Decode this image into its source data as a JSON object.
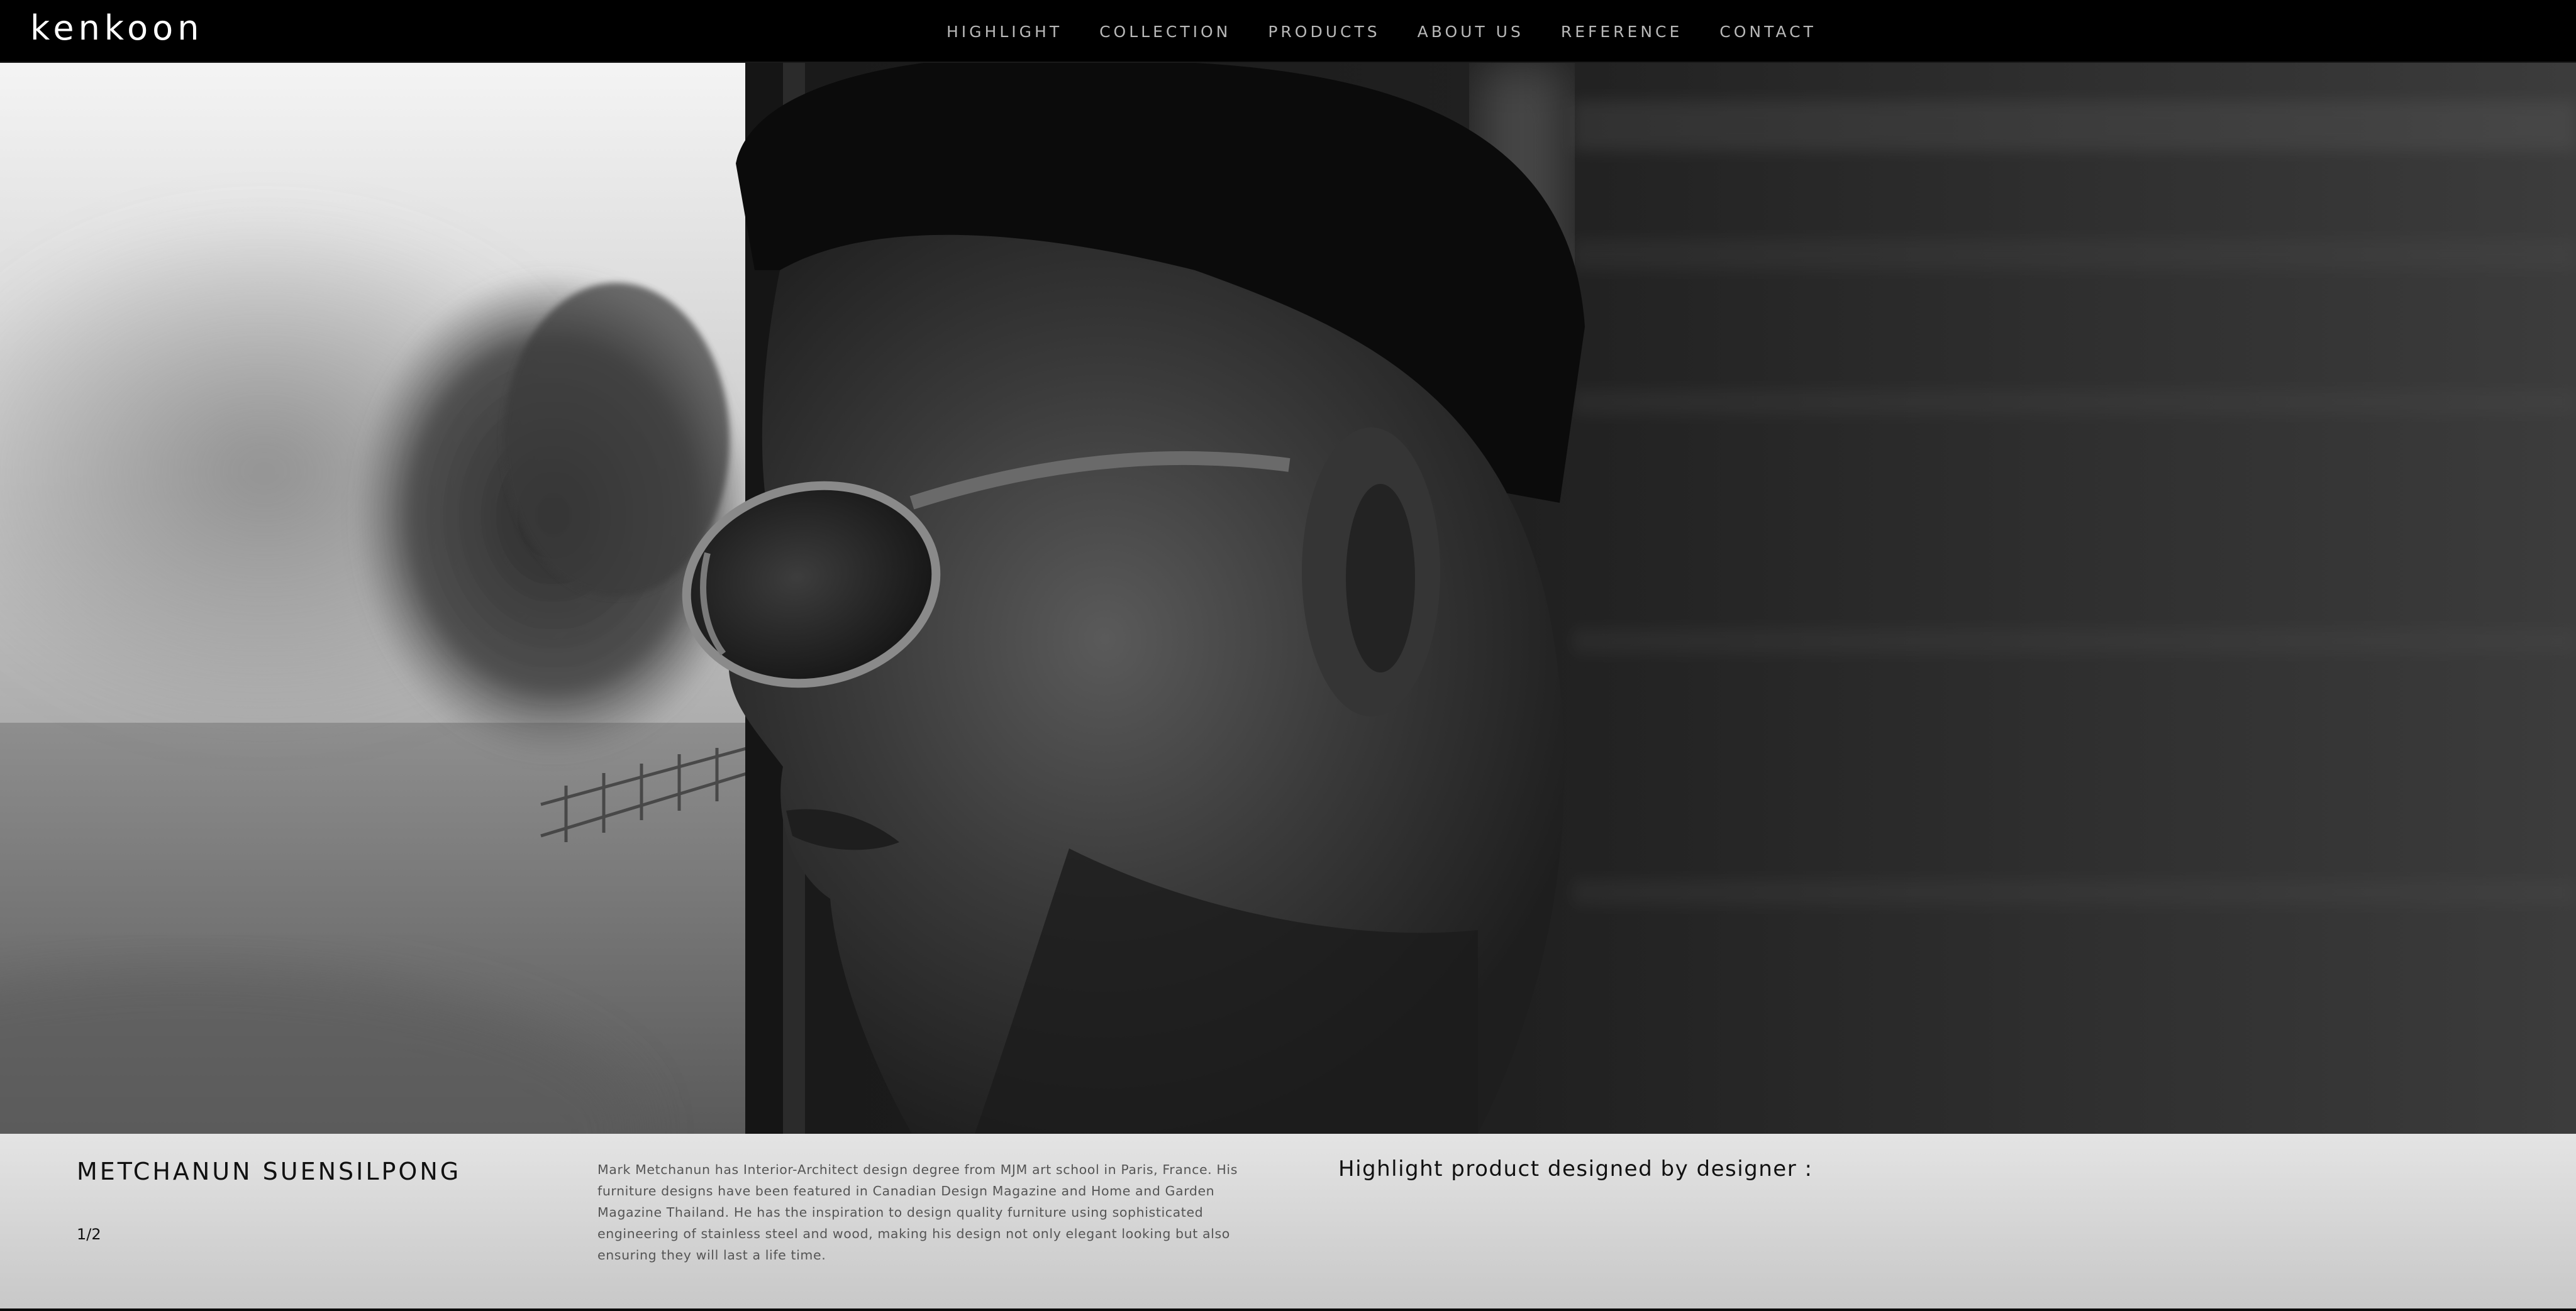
{
  "header": {
    "logo": "kenkoon",
    "nav": [
      {
        "label": "HIGHLIGHT"
      },
      {
        "label": "COLLECTION"
      },
      {
        "label": "PRODUCTS"
      },
      {
        "label": "ABOUT US"
      },
      {
        "label": "REFERENCE"
      },
      {
        "label": "CONTACT"
      }
    ]
  },
  "hero": {
    "image_description": "black-and-white portrait of a man wearing aviator sunglasses looking out of a window",
    "slider": {
      "current": 1,
      "total": 2
    }
  },
  "designer": {
    "name": "METCHANUN SUENSILPONG",
    "counter": "1/2",
    "bio": "Mark Metchanun has Interior-Architect design degree from MJM art school in Paris, France. His furniture designs have been featured in Canadian Design Magazine and Home and Garden Magazine Thailand. He has the inspiration to design quality furniture using sophisticated engineering of stainless steel and wood, making his design not only elegant looking but also ensuring they will last a life time.",
    "highlight_title": "Highlight product designed by designer :"
  },
  "colors": {
    "nav_bg": "#000000",
    "nav_text": "#b8b8b8",
    "dot_active": "#7a6246",
    "info_bg": "#d8d8d8"
  }
}
